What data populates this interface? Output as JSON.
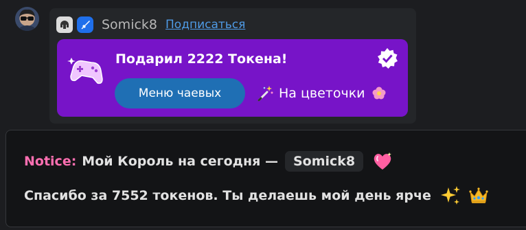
{
  "message": {
    "username": "Somick8",
    "subscribe_label": "Подписаться",
    "badges": [
      "mod-badge-icon",
      "sword-badge-icon"
    ],
    "tip": {
      "title": "Подарил 2222 Токена!",
      "menu_button_label": "Меню чаевых",
      "note": "На цветочки",
      "background_color": "#7714c8",
      "button_color": "#1f6fb4"
    }
  },
  "notice": {
    "label": "Notice:",
    "king_text": "Мой Король на сегодня —",
    "king_name": "Somick8",
    "thanks_text": "Спасибо за 7552 токенов. Ты делаешь мой день ярче",
    "label_color": "#ff6fb1"
  }
}
